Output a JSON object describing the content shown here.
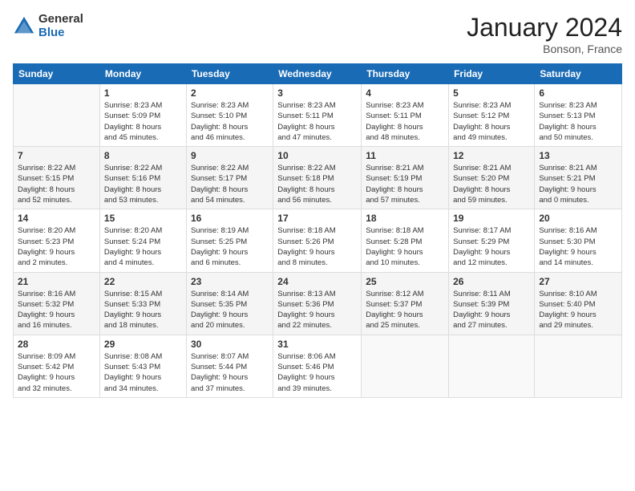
{
  "logo": {
    "general": "General",
    "blue": "Blue"
  },
  "title": "January 2024",
  "location": "Bonson, France",
  "days_header": [
    "Sunday",
    "Monday",
    "Tuesday",
    "Wednesday",
    "Thursday",
    "Friday",
    "Saturday"
  ],
  "weeks": [
    [
      {
        "day": "",
        "info": ""
      },
      {
        "day": "1",
        "info": "Sunrise: 8:23 AM\nSunset: 5:09 PM\nDaylight: 8 hours\nand 45 minutes."
      },
      {
        "day": "2",
        "info": "Sunrise: 8:23 AM\nSunset: 5:10 PM\nDaylight: 8 hours\nand 46 minutes."
      },
      {
        "day": "3",
        "info": "Sunrise: 8:23 AM\nSunset: 5:11 PM\nDaylight: 8 hours\nand 47 minutes."
      },
      {
        "day": "4",
        "info": "Sunrise: 8:23 AM\nSunset: 5:11 PM\nDaylight: 8 hours\nand 48 minutes."
      },
      {
        "day": "5",
        "info": "Sunrise: 8:23 AM\nSunset: 5:12 PM\nDaylight: 8 hours\nand 49 minutes."
      },
      {
        "day": "6",
        "info": "Sunrise: 8:23 AM\nSunset: 5:13 PM\nDaylight: 8 hours\nand 50 minutes."
      }
    ],
    [
      {
        "day": "7",
        "info": "Sunrise: 8:22 AM\nSunset: 5:15 PM\nDaylight: 8 hours\nand 52 minutes."
      },
      {
        "day": "8",
        "info": "Sunrise: 8:22 AM\nSunset: 5:16 PM\nDaylight: 8 hours\nand 53 minutes."
      },
      {
        "day": "9",
        "info": "Sunrise: 8:22 AM\nSunset: 5:17 PM\nDaylight: 8 hours\nand 54 minutes."
      },
      {
        "day": "10",
        "info": "Sunrise: 8:22 AM\nSunset: 5:18 PM\nDaylight: 8 hours\nand 56 minutes."
      },
      {
        "day": "11",
        "info": "Sunrise: 8:21 AM\nSunset: 5:19 PM\nDaylight: 8 hours\nand 57 minutes."
      },
      {
        "day": "12",
        "info": "Sunrise: 8:21 AM\nSunset: 5:20 PM\nDaylight: 8 hours\nand 59 minutes."
      },
      {
        "day": "13",
        "info": "Sunrise: 8:21 AM\nSunset: 5:21 PM\nDaylight: 9 hours\nand 0 minutes."
      }
    ],
    [
      {
        "day": "14",
        "info": "Sunrise: 8:20 AM\nSunset: 5:23 PM\nDaylight: 9 hours\nand 2 minutes."
      },
      {
        "day": "15",
        "info": "Sunrise: 8:20 AM\nSunset: 5:24 PM\nDaylight: 9 hours\nand 4 minutes."
      },
      {
        "day": "16",
        "info": "Sunrise: 8:19 AM\nSunset: 5:25 PM\nDaylight: 9 hours\nand 6 minutes."
      },
      {
        "day": "17",
        "info": "Sunrise: 8:18 AM\nSunset: 5:26 PM\nDaylight: 9 hours\nand 8 minutes."
      },
      {
        "day": "18",
        "info": "Sunrise: 8:18 AM\nSunset: 5:28 PM\nDaylight: 9 hours\nand 10 minutes."
      },
      {
        "day": "19",
        "info": "Sunrise: 8:17 AM\nSunset: 5:29 PM\nDaylight: 9 hours\nand 12 minutes."
      },
      {
        "day": "20",
        "info": "Sunrise: 8:16 AM\nSunset: 5:30 PM\nDaylight: 9 hours\nand 14 minutes."
      }
    ],
    [
      {
        "day": "21",
        "info": "Sunrise: 8:16 AM\nSunset: 5:32 PM\nDaylight: 9 hours\nand 16 minutes."
      },
      {
        "day": "22",
        "info": "Sunrise: 8:15 AM\nSunset: 5:33 PM\nDaylight: 9 hours\nand 18 minutes."
      },
      {
        "day": "23",
        "info": "Sunrise: 8:14 AM\nSunset: 5:35 PM\nDaylight: 9 hours\nand 20 minutes."
      },
      {
        "day": "24",
        "info": "Sunrise: 8:13 AM\nSunset: 5:36 PM\nDaylight: 9 hours\nand 22 minutes."
      },
      {
        "day": "25",
        "info": "Sunrise: 8:12 AM\nSunset: 5:37 PM\nDaylight: 9 hours\nand 25 minutes."
      },
      {
        "day": "26",
        "info": "Sunrise: 8:11 AM\nSunset: 5:39 PM\nDaylight: 9 hours\nand 27 minutes."
      },
      {
        "day": "27",
        "info": "Sunrise: 8:10 AM\nSunset: 5:40 PM\nDaylight: 9 hours\nand 29 minutes."
      }
    ],
    [
      {
        "day": "28",
        "info": "Sunrise: 8:09 AM\nSunset: 5:42 PM\nDaylight: 9 hours\nand 32 minutes."
      },
      {
        "day": "29",
        "info": "Sunrise: 8:08 AM\nSunset: 5:43 PM\nDaylight: 9 hours\nand 34 minutes."
      },
      {
        "day": "30",
        "info": "Sunrise: 8:07 AM\nSunset: 5:44 PM\nDaylight: 9 hours\nand 37 minutes."
      },
      {
        "day": "31",
        "info": "Sunrise: 8:06 AM\nSunset: 5:46 PM\nDaylight: 9 hours\nand 39 minutes."
      },
      {
        "day": "",
        "info": ""
      },
      {
        "day": "",
        "info": ""
      },
      {
        "day": "",
        "info": ""
      }
    ]
  ]
}
